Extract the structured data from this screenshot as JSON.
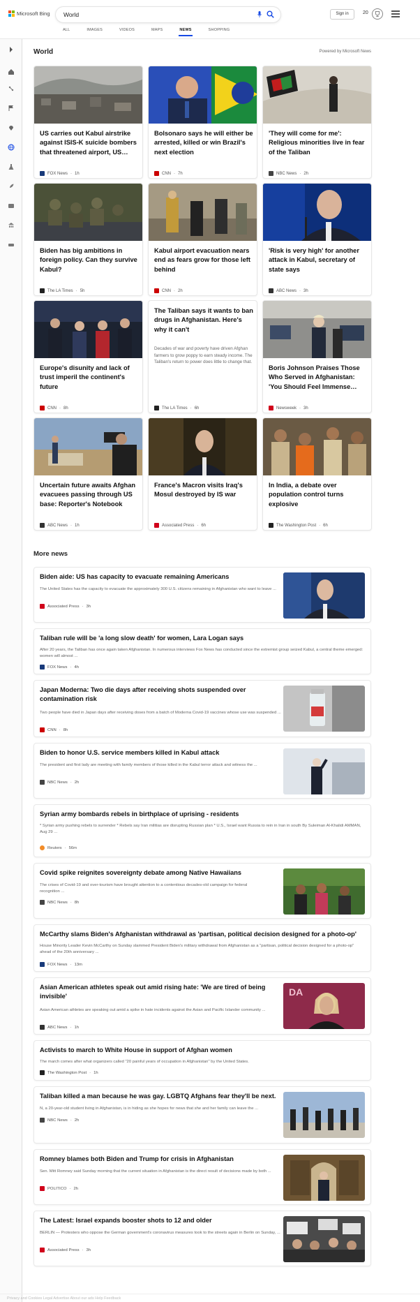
{
  "header": {
    "brand": "Microsoft Bing",
    "search_value": "World",
    "signin": "Sign in",
    "points": "20",
    "scopes": [
      "ALL",
      "IMAGES",
      "VIDEOS",
      "MAPS",
      "NEWS",
      "SHOPPING"
    ],
    "active_scope": "NEWS"
  },
  "rail_icons": [
    "expand-icon",
    "home-icon",
    "technology-icon",
    "flag-icon",
    "location-icon",
    "world-icon",
    "science-icon",
    "rocket-icon",
    "entertainment-icon",
    "money-icon",
    "car-icon"
  ],
  "world": {
    "title": "World",
    "powered_by": "Powered by Microsoft News",
    "cards": [
      {
        "title": "US carries out Kabul airstrike against ISIS-K suicide bombers that threatened airport, US…",
        "source": "FOX News",
        "time": "1h",
        "logo_color": "#183a7a"
      },
      {
        "title": "Bolsonaro says he will either be arrested, killed or win Brazil's next election",
        "source": "CNN",
        "time": "7h",
        "logo_color": "#cc0000"
      },
      {
        "title": "'They will come for me': Religious minorities live in fear of the Taliban",
        "source": "NBC News",
        "time": "2h",
        "logo_color": "#444444"
      },
      {
        "title": "Biden has big ambitions in foreign policy. Can they survive Kabul?",
        "source": "The LA Times",
        "time": "5h",
        "logo_color": "#222222"
      },
      {
        "title": "Kabul airport evacuation nears end as fears grow for those left behind",
        "source": "CNN",
        "time": "2h",
        "logo_color": "#cc0000"
      },
      {
        "title": "'Risk is very high' for another attack in Kabul, secretary of state says",
        "source": "ABC News",
        "time": "3h",
        "logo_color": "#333333"
      },
      {
        "title": "Europe's disunity and lack of trust imperil the continent's future",
        "source": "CNN",
        "time": "8h",
        "logo_color": "#cc0000"
      },
      {
        "title": "The Taliban says it wants to ban drugs in Afghanistan. Here's why it can't",
        "desc": "Decades of war and poverty have driven Afghan farmers to grow poppy to earn steady income. The Taliban's return to power does little to change that.",
        "source": "The LA Times",
        "time": "6h",
        "logo_color": "#222222"
      },
      {
        "title": "Boris Johnson Praises Those Who Served in Afghanistan: 'You Should Feel Immense…",
        "source": "Newsweek",
        "time": "3h",
        "logo_color": "#d0021b"
      },
      {
        "title": "Uncertain future awaits Afghan evacuees passing through US base: Reporter's Notebook",
        "source": "ABC News",
        "time": "1h",
        "logo_color": "#333333"
      },
      {
        "title": "France's Macron visits Iraq's Mosul destroyed by IS war",
        "source": "Associated Press",
        "time": "6h",
        "logo_color": "#d0021b"
      },
      {
        "title": "In India, a debate over population control turns explosive",
        "source": "The Washington Post",
        "time": "6h",
        "logo_color": "#222222"
      }
    ]
  },
  "more_news": {
    "title": "More news",
    "items": [
      {
        "title": "Biden aide: US has capacity to evacuate remaining Americans",
        "desc": "The United States has the capacity to evacuate the approximately 300 U.S. citizens remaining in Afghanistan who want to leave ...",
        "source": "Associated Press",
        "time": "3h",
        "logo_color": "#d0021b"
      },
      {
        "title": "Taliban rule will be 'a long slow death' for women, Lara Logan says",
        "desc": "After 20 years, the Taliban has once again taken Afghanistan. In numerous interviews Fox News has conducted since the extremist group seized Kabul, a central theme emerged: women will almost ...",
        "source": "FOX News",
        "time": "4h",
        "logo_color": "#183a7a"
      },
      {
        "title": "Japan Moderna: Two die days after receiving shots suspended over contamination risk",
        "desc": "Two people have died in Japan days after receiving doses from a batch of Moderna Covid-19 vaccines whose use was suspended ...",
        "source": "CNN",
        "time": "8h",
        "logo_color": "#cc0000"
      },
      {
        "title": "Biden to honor U.S. service members killed in Kabul attack",
        "desc": "The president and first lady are meeting with family members of those killed in the Kabul terror attack and witness the ...",
        "source": "NBC News",
        "time": "2h",
        "logo_color": "#444444"
      },
      {
        "title": "Syrian army bombards rebels in birthplace of uprising - residents",
        "desc": "* Syrian army pushing rebels to surrender * Rebels say Iran militias are disrupting Russian plan * U.S., Israel want Russia to rein in Iran in south By Suleiman Al-Khalidi AMMAN, Aug 29 ...",
        "source": "Reuters",
        "time": "56m",
        "logo_color": "#f28c28"
      },
      {
        "title": "Covid spike reignites sovereignty debate among Native Hawaiians",
        "desc": "The crises of Covid-19 and over-tourism have brought attention to a contentious decades-old campaign for federal recognition ...",
        "source": "NBC News",
        "time": "8h",
        "logo_color": "#444444"
      },
      {
        "title": "McCarthy slams Biden's Afghanistan withdrawal as 'partisan, political decision designed for a photo-op'",
        "desc": "House Minority Leader Kevin McCarthy on Sunday slammed President Biden's military withdrawal from Afghanistan as a \"partisan, political decision designed for a photo-op\" ahead of the 20th anniversary ...",
        "source": "FOX News",
        "time": "13m",
        "logo_color": "#183a7a"
      },
      {
        "title": "Asian American athletes speak out amid rising hate: 'We are tired of being invisible'",
        "desc": "Asian American athletes are speaking out amid a spike in hate incidents against the Asian and Pacific Islander community ...",
        "source": "ABC News",
        "time": "1h",
        "logo_color": "#333333"
      },
      {
        "title": "Activists to march to White House in support of Afghan women",
        "desc": "The march comes after what organizers called \"20 painful years of occupation in Afghanistan\" by the United States.",
        "source": "The Washington Post",
        "time": "1h",
        "logo_color": "#222222"
      },
      {
        "title": "Taliban killed a man because he was gay. LGBTQ Afghans fear they'll be next.",
        "desc": "N, a 20-year-old student living in Afghanistan, is in hiding as she hopes for news that she and her family can leave the ...",
        "source": "NBC News",
        "time": "2h",
        "logo_color": "#444444"
      },
      {
        "title": "Romney blames both Biden and Trump for crisis in Afghanistan",
        "desc": "Sen. Mitt Romney said Sunday morning that the current situation in Afghanistan is the direct result of decisions made by both ...",
        "source": "POLITICO",
        "time": "2h",
        "logo_color": "#d0021b"
      },
      {
        "title": "The Latest: Israel expands booster shots to 12 and older",
        "desc": "BERLIN — Protesters who oppose the German government's coronavirus measures took to the streets again in Berlin on Sunday, ...",
        "source": "Associated Press",
        "time": "3h",
        "logo_color": "#d0021b"
      }
    ]
  },
  "footer_text": "Privacy and Cookies  Legal  Advertise  About our ads  Help  Feedback"
}
